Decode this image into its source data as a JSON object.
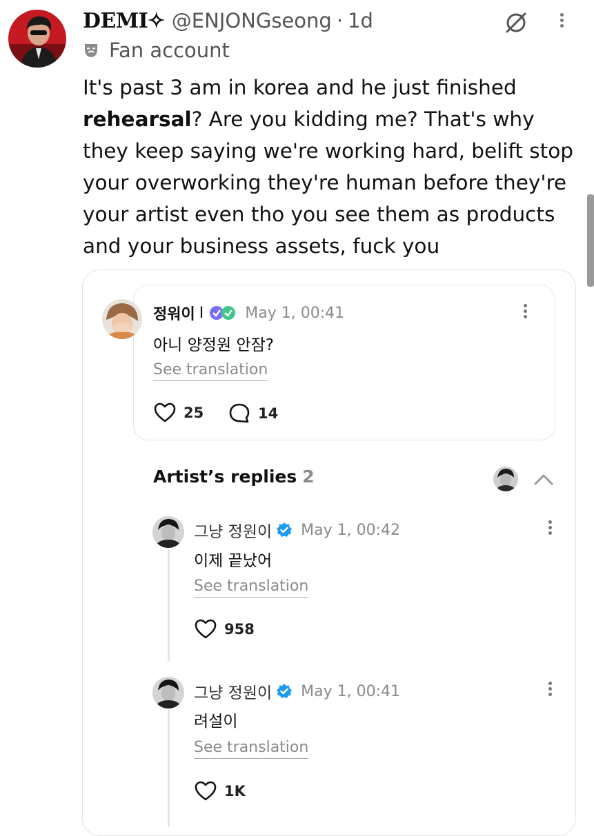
{
  "tweet": {
    "display_name": "DEMI✧",
    "handle": "@ENJONGseong",
    "separator": "·",
    "time_ago": "1d",
    "account_label": "Fan account",
    "text_before": "It's past 3 am in korea and he just finished ",
    "text_bold": "rehearsal",
    "text_after": "? Are you kidding me? That's why they keep saying we're working hard, belift stop your overworking they're human before they're your artist even tho you see them as products and your business assets, fuck you"
  },
  "quoted_post": {
    "author": "정워이",
    "separator": "I",
    "time": "May 1, 00:41",
    "text": "아니 양정원 안잠?",
    "translate_label": "See translation",
    "likes": "25",
    "comments": "14"
  },
  "artist_replies": {
    "title": "Artist’s replies",
    "count": "2",
    "replies": [
      {
        "author": "그냥 정원이",
        "time": "May 1, 00:42",
        "text": "이제 끝났어",
        "translate_label": "See translation",
        "likes": "958"
      },
      {
        "author": "그냥 정원이",
        "time": "May 1, 00:41",
        "text": "려설이",
        "translate_label": "See translation",
        "likes": "1K"
      }
    ]
  },
  "icons": {
    "main_avatar": "avatar",
    "fan_badge": "mask-icon",
    "header_action": "slashed-circle-icon",
    "more": "kebab-icon",
    "like": "heart-icon",
    "comment": "comment-icon",
    "verified": "verified-badge-icon",
    "collapse": "chevron-up-icon"
  },
  "colors": {
    "verified": "#1d9bf0",
    "muted_text": "#8a8a8a",
    "text": "#111111"
  }
}
